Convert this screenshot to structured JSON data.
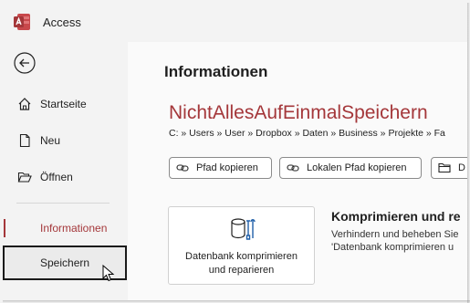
{
  "app": {
    "title": "Access",
    "accent_color": "#a4373a"
  },
  "nav": {
    "back_icon": "back-arrow-icon",
    "items": [
      {
        "label": "Startseite",
        "icon": "home-icon"
      },
      {
        "label": "Neu",
        "icon": "new-document-icon"
      },
      {
        "label": "Öffnen",
        "icon": "folder-open-icon"
      },
      {
        "label": "Informationen",
        "state": "selected"
      },
      {
        "label": "Speichern",
        "state": "hovered"
      }
    ]
  },
  "main": {
    "heading": "Informationen",
    "database_name": "NichtAllesAufEinmalSpeichern",
    "path": "C: » Users » User » Dropbox » Daten » Business » Projekte » Fa",
    "path_buttons": [
      {
        "label": "Pfad kopieren",
        "icon": "link-icon"
      },
      {
        "label": "Lokalen Pfad kopieren",
        "icon": "link-icon"
      },
      {
        "label": "D",
        "icon": "folder-icon"
      }
    ],
    "compact_card": {
      "line1": "Datenbank komprimieren",
      "line2": "und reparieren",
      "icon": "database-tools-icon"
    },
    "compact_section": {
      "title": "Komprimieren und re",
      "desc_line1": "Verhindern und beheben Sie",
      "desc_line2": "'Datenbank komprimieren u"
    }
  }
}
